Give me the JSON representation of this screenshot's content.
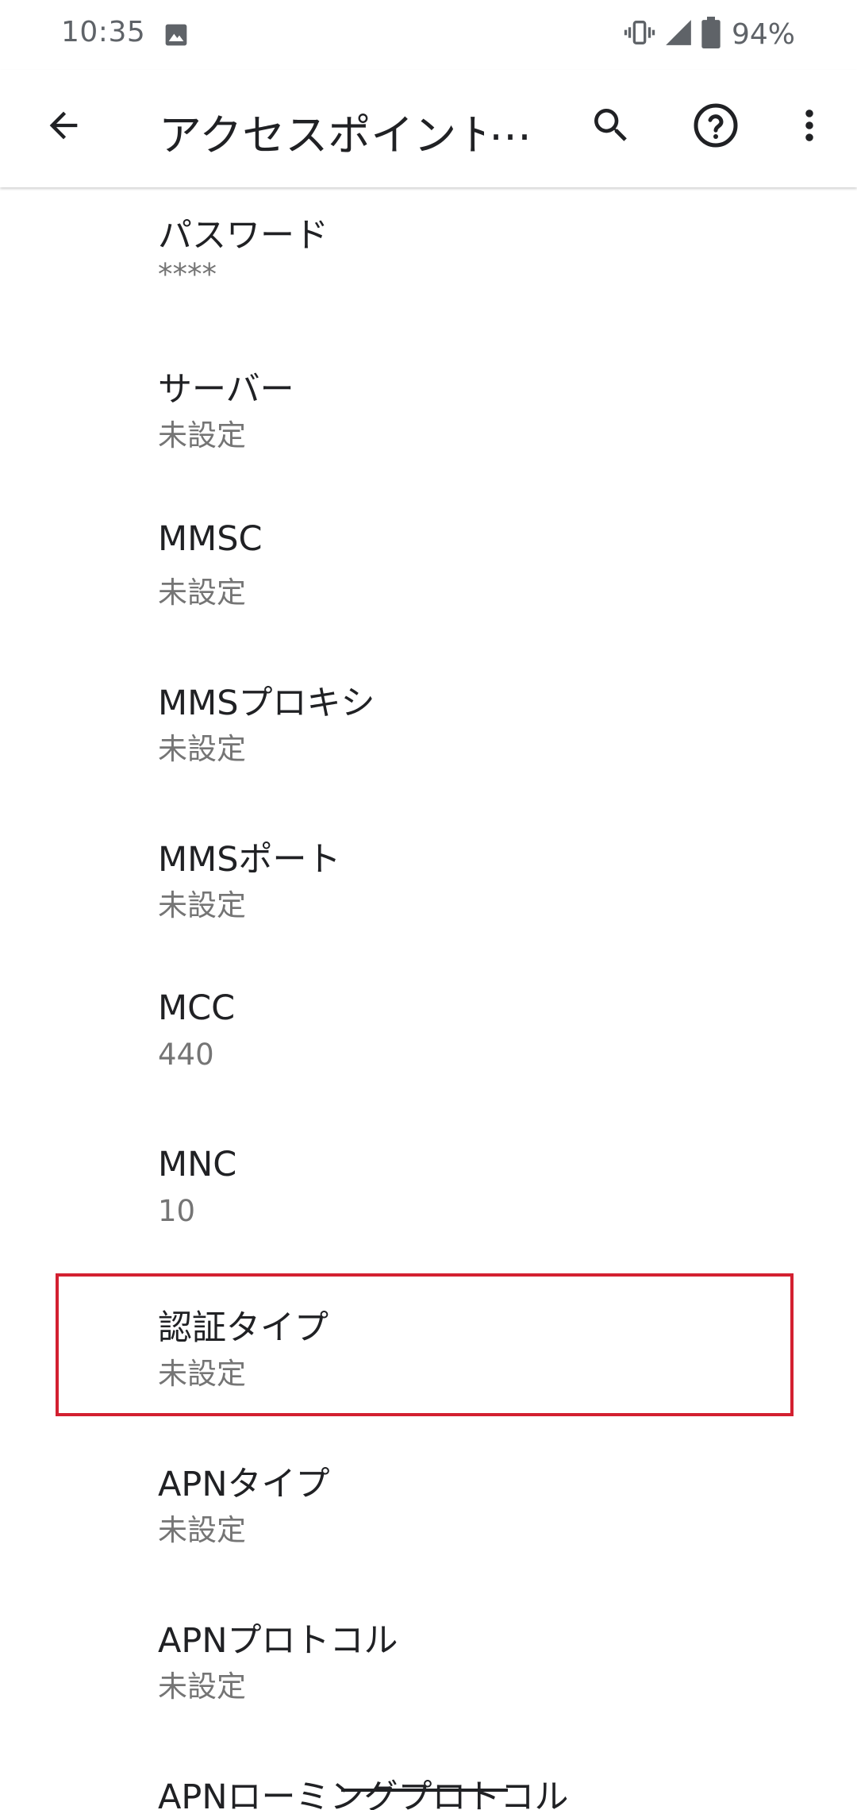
{
  "status_bar": {
    "time": "10:35",
    "battery_percent": "94%",
    "icons": [
      "image-icon",
      "vibrate-icon",
      "cell-signal-icon",
      "battery-icon"
    ]
  },
  "app_bar": {
    "title": "アクセスポイント",
    "title_ellipsis": "…",
    "icons": [
      "back-arrow-icon",
      "search-icon",
      "help-icon",
      "more-vert-icon"
    ]
  },
  "items": [
    {
      "title": "パスワード",
      "summary": "****"
    },
    {
      "title": "サーバー",
      "summary": "未設定"
    },
    {
      "title": "MMSC",
      "summary": "未設定"
    },
    {
      "title": "MMSプロキシ",
      "summary": "未設定"
    },
    {
      "title": "MMSポート",
      "summary": "未設定"
    },
    {
      "title": "MCC",
      "summary": "440"
    },
    {
      "title": "MNC",
      "summary": "10"
    },
    {
      "title": "認証タイプ",
      "summary": "未設定"
    },
    {
      "title": "APNタイプ",
      "summary": "未設定"
    },
    {
      "title": "APNプロトコル",
      "summary": "未設定"
    },
    {
      "title": "APNローミングプロトコル",
      "summary": ""
    }
  ],
  "colors": {
    "highlight": "#d32030",
    "text_primary": "#202124",
    "text_secondary": "#757575",
    "status_text": "#5f6368"
  }
}
